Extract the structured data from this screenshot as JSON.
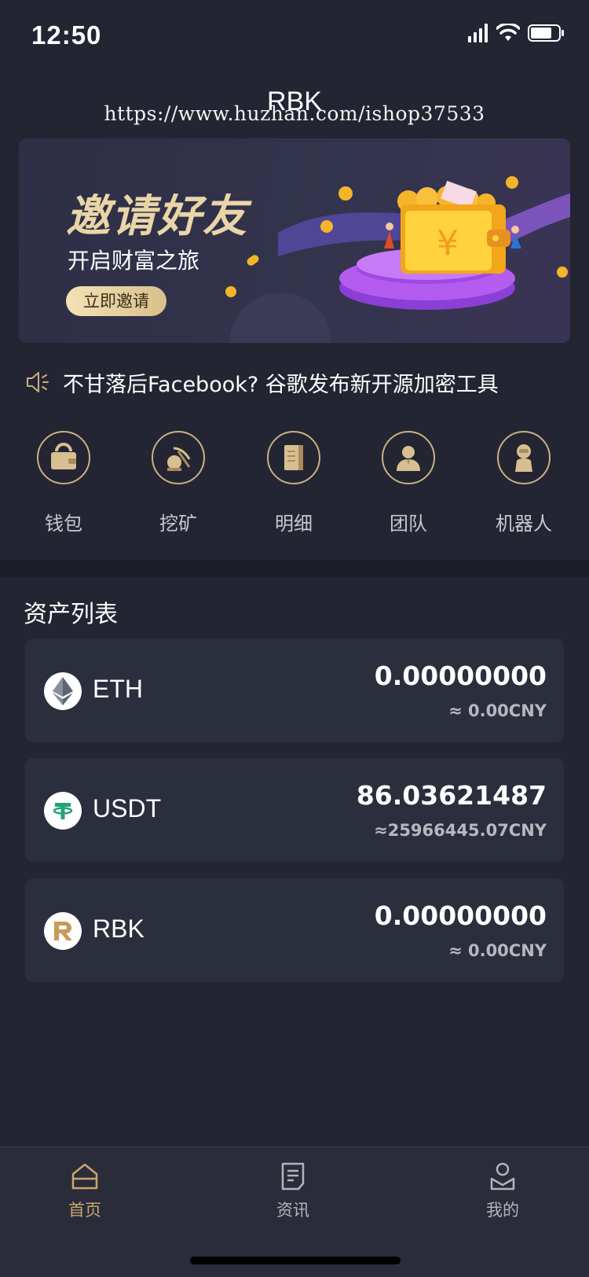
{
  "status_bar": {
    "time": "12:50"
  },
  "header": {
    "title": "RBK",
    "watermark": "https://www.huzhan.com/ishop37533"
  },
  "banner": {
    "title": "邀请好友",
    "subtitle": "开启财富之旅",
    "button_label": "立即邀请",
    "currency_symbol": "¥"
  },
  "notice": {
    "icon": "speaker-icon",
    "text": "不甘落后Facebook?  谷歌发布新开源加密工具"
  },
  "menu": {
    "items": [
      {
        "label": "钱包",
        "icon": "wallet-icon"
      },
      {
        "label": "挖矿",
        "icon": "pickaxe-icon"
      },
      {
        "label": "明细",
        "icon": "ledger-icon"
      },
      {
        "label": "团队",
        "icon": "team-icon"
      },
      {
        "label": "机器人",
        "icon": "robot-icon"
      }
    ]
  },
  "assets": {
    "title": "资产列表",
    "items": [
      {
        "symbol": "ETH",
        "amount": "0.00000000",
        "cny": "≈ 0.00CNY",
        "icon": "eth-icon"
      },
      {
        "symbol": "USDT",
        "amount": "86.03621487",
        "cny": "≈25966445.07CNY",
        "icon": "usdt-icon"
      },
      {
        "symbol": "RBK",
        "amount": "0.00000000",
        "cny": "≈ 0.00CNY",
        "icon": "rbk-icon"
      }
    ]
  },
  "tabbar": {
    "items": [
      {
        "label": "首页",
        "icon": "home-icon",
        "active": true
      },
      {
        "label": "资讯",
        "icon": "news-icon",
        "active": false
      },
      {
        "label": "我的",
        "icon": "profile-icon",
        "active": false
      }
    ]
  },
  "colors": {
    "background": "#232532",
    "card": "#2b2e3d",
    "gold": "#c9b184",
    "active_tab": "#c9a76a",
    "inactive_tab": "#b3b4bb"
  }
}
